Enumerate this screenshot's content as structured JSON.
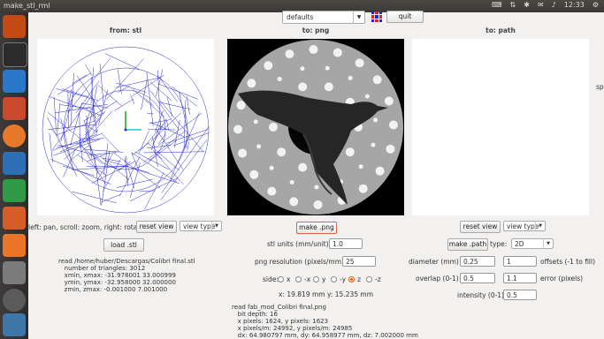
{
  "window": {
    "title": "make_stl_rml",
    "clock": "12:33"
  },
  "toolbar": {
    "preset": "defaults",
    "quit_label": "quit"
  },
  "panels": {
    "from": {
      "title": "from: stl"
    },
    "to_png": {
      "title": "to: png"
    },
    "to_path": {
      "title": "to: path"
    }
  },
  "stl": {
    "hint": "left: pan, scroll: zoom, right: rotate",
    "reset_view_label": "reset view",
    "view_type": "view type",
    "load_label": "load .stl",
    "info": "read /home/huber/Descargas/Colibri final.stl\n   number of triangles: 3012\n   xmin, xmax: -31.978001 33.000999\n   ymin, ymax: -32.958000 32.000000\n   zmin, zmax: -0.001000 7.001000"
  },
  "png": {
    "make_label": "make .png",
    "units_label": "stl units (mm/unit):",
    "units_value": "1.0",
    "resolution_label": "png resolution (pixels/mm):",
    "resolution_value": "25",
    "side_label": "side:",
    "sides": [
      "x",
      "-x",
      "y",
      "-y",
      "z",
      "-z"
    ],
    "selected_side": "z",
    "size_readout": "x: 19.819 mm  y: 15.235 mm",
    "info": "read fab_mod_Colibri final.png\n   bit depth: 16\n   x pixels: 1624, y pixels: 1623\n   x pixels/m: 24992, y pixels/m: 24985\n   dx: 64.980797 mm, dy: 64.958977 mm, dz: 7.002000 mm"
  },
  "path": {
    "reset_view_label": "reset view",
    "view_type": "view type",
    "make_label": "make .path",
    "type_label": "type:",
    "type_value": "2D",
    "diameter_label": "diameter (mm)",
    "diameter_value": "0.25",
    "offsets_value": "1",
    "offsets_label": "offsets (-1 to fill)",
    "overlap_label": "overlap (0-1)",
    "overlap_value": "0.5",
    "error_value": "1.1",
    "error_label": "error (pixels)",
    "intensity_label": "intensity (0-1)",
    "intensity_value": "0.5",
    "edge_label": "sp"
  }
}
